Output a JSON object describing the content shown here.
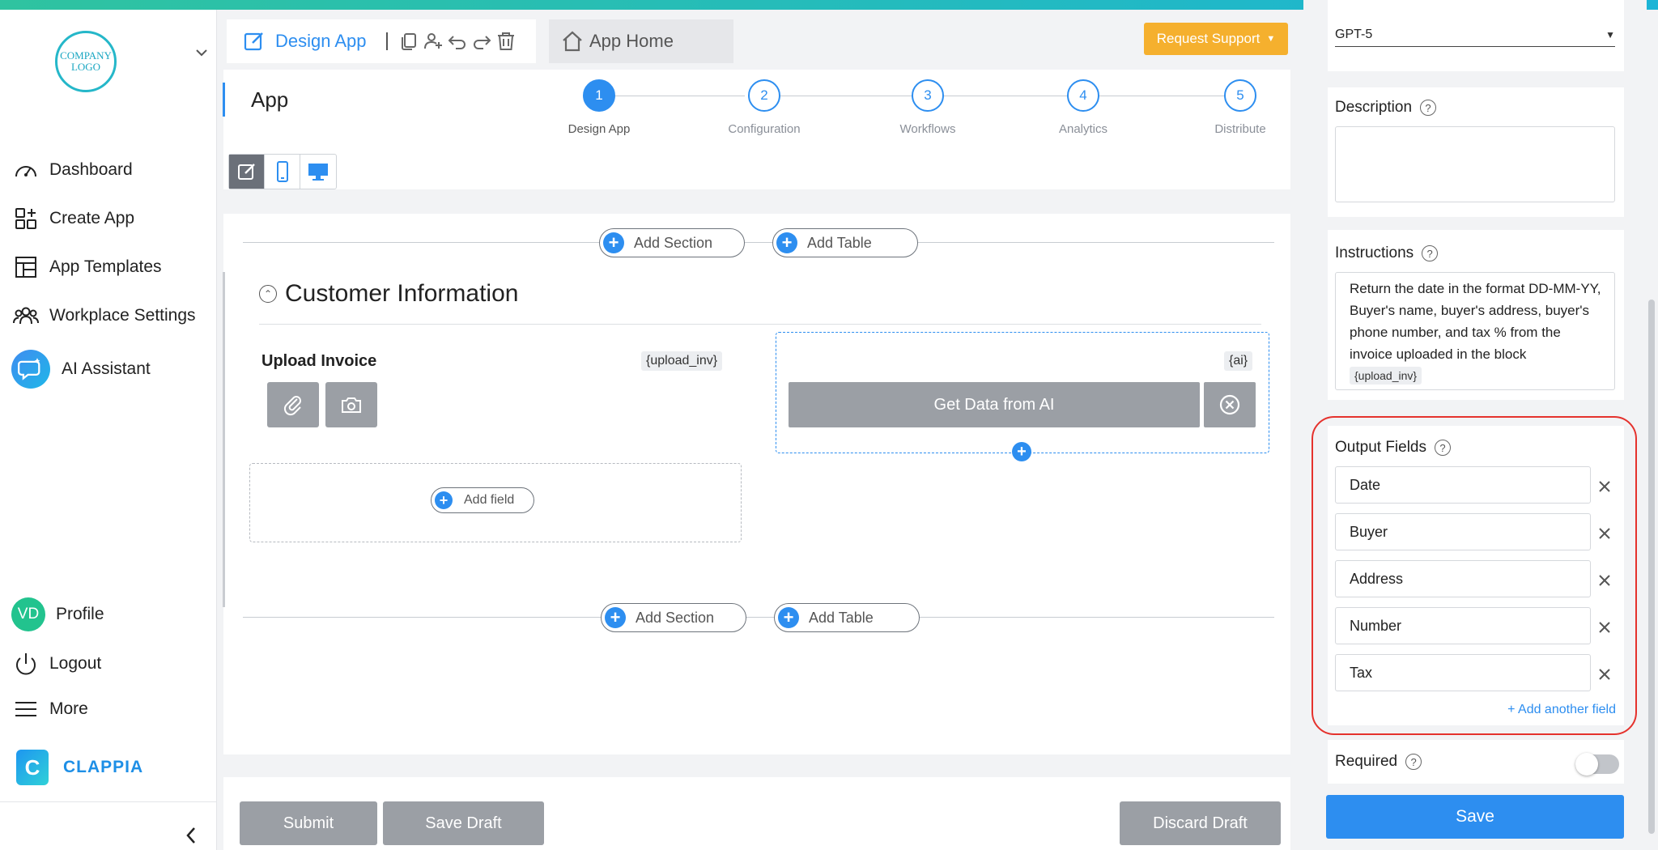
{
  "sidebar": {
    "logo_text": "COMPANY LOGO",
    "items": [
      {
        "label": "Dashboard",
        "icon": "gauge-icon"
      },
      {
        "label": "Create App",
        "icon": "create-app-icon"
      },
      {
        "label": "App Templates",
        "icon": "templates-icon"
      },
      {
        "label": "Workplace Settings",
        "icon": "users-icon"
      },
      {
        "label": "AI Assistant",
        "icon": "ai-chat-icon"
      }
    ],
    "profile": {
      "initials": "VD",
      "label": "Profile"
    },
    "logout_label": "Logout",
    "more_label": "More",
    "brand": "CLAPPIA"
  },
  "header": {
    "design_tab": "Design App",
    "home_tab": "App Home",
    "request_support": "Request Support"
  },
  "app": {
    "title": "App",
    "steps": [
      {
        "num": "1",
        "label": "Design App"
      },
      {
        "num": "2",
        "label": "Configuration"
      },
      {
        "num": "3",
        "label": "Workflows"
      },
      {
        "num": "4",
        "label": "Analytics"
      },
      {
        "num": "5",
        "label": "Distribute"
      }
    ]
  },
  "canvas": {
    "add_section": "Add Section",
    "add_table": "Add Table",
    "section_title": "Customer Information",
    "upload_label": "Upload Invoice",
    "upload_var": "{upload_inv}",
    "ai_var": "{ai}",
    "get_ai": "Get Data from AI",
    "add_field": "Add field"
  },
  "footer": {
    "submit": "Submit",
    "save_draft": "Save Draft",
    "discard_draft": "Discard Draft"
  },
  "panel": {
    "model_value": "GPT-5",
    "description_label": "Description",
    "instructions_label": "Instructions",
    "instructions_text": "Return the date in the format DD-MM-YY, Buyer's name, buyer's address, buyer's phone number, and tax % from the invoice uploaded in the block",
    "instructions_var": "{upload_inv}",
    "output_label": "Output Fields",
    "output_fields": [
      "Date",
      "Buyer",
      "Address",
      "Number",
      "Tax"
    ],
    "add_another": "+ Add another field",
    "required_label": "Required",
    "required_on": false,
    "save": "Save"
  },
  "colors": {
    "accent": "#2d8ef0",
    "support": "#f5b02e",
    "highlight": "#e5322d"
  }
}
